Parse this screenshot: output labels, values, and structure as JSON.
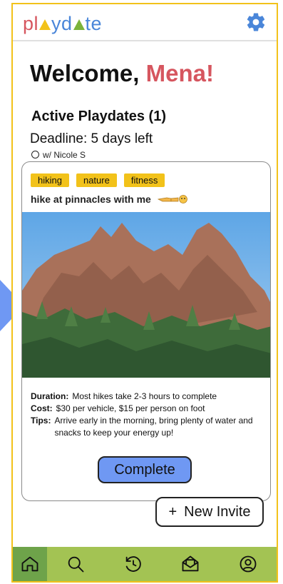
{
  "app": {
    "logo": {
      "part1": "pl",
      "part2": "yd",
      "part3": "te"
    }
  },
  "colors": {
    "accent_red": "#d6565f",
    "accent_yellow": "#f2c21a",
    "accent_blue": "#6f98f3",
    "nav_green": "#a3c353"
  },
  "welcome": {
    "prefix": "Welcome,",
    "name": "Mena!"
  },
  "active": {
    "title": "Active Playdates (1)",
    "deadline": "Deadline: 5 days left",
    "with": "w/ Nicole S"
  },
  "card": {
    "tags": [
      "hiking",
      "nature",
      "fitness"
    ],
    "description": "hike at pinnacles with me",
    "details": [
      {
        "label": "Duration:",
        "value": "Most hikes take 2-3 hours to complete"
      },
      {
        "label": "Cost:",
        "value": "$30 per vehicle, $15 per person on foot"
      },
      {
        "label": "Tips:",
        "value": "Arrive early in the morning, bring plenty of water and snacks to keep your energy up!"
      }
    ],
    "complete_label": "Complete"
  },
  "new_invite": {
    "plus": "+",
    "label": "New Invite"
  },
  "nav": {
    "items": [
      {
        "icon": "home-icon",
        "active": true
      },
      {
        "icon": "search-icon",
        "active": false
      },
      {
        "icon": "history-icon",
        "active": false
      },
      {
        "icon": "inbox-icon",
        "active": false
      },
      {
        "icon": "profile-icon",
        "active": false
      }
    ]
  }
}
